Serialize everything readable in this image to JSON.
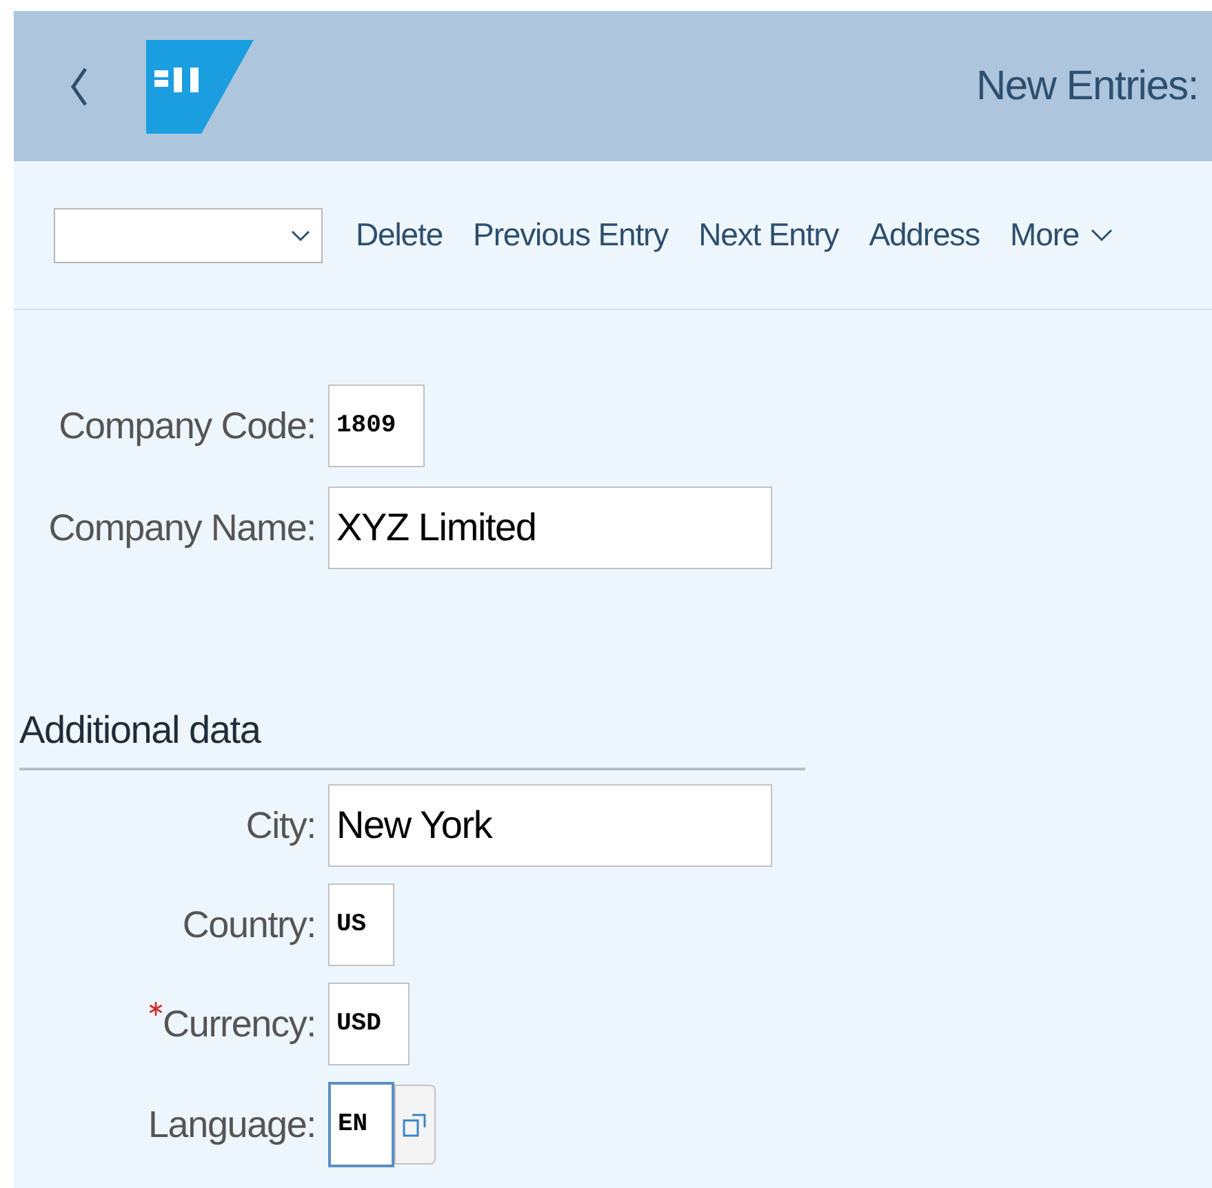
{
  "header": {
    "title": "New Entries:"
  },
  "toolbar": {
    "buttons": [
      "Delete",
      "Previous Entry",
      "Next Entry",
      "Address"
    ],
    "more": "More"
  },
  "fields": [
    {
      "label": "Company Code:",
      "value": "1809",
      "kind": "code",
      "required": false,
      "focused": false
    },
    {
      "label": "Company Name:",
      "value": "XYZ Limited",
      "kind": "text",
      "required": false,
      "focused": false
    }
  ],
  "section": {
    "title": "Additional data",
    "fields": [
      {
        "label": "City:",
        "value": "New York",
        "kind": "text",
        "required": false,
        "focused": false
      },
      {
        "label": "Country:",
        "value": "US",
        "kind": "code",
        "required": false,
        "focused": false
      },
      {
        "label": "Currency:",
        "value": "USD",
        "kind": "code",
        "required": true,
        "focused": false
      },
      {
        "label": "Language:",
        "value": "EN",
        "kind": "code_help",
        "required": false,
        "focused": true
      }
    ]
  }
}
